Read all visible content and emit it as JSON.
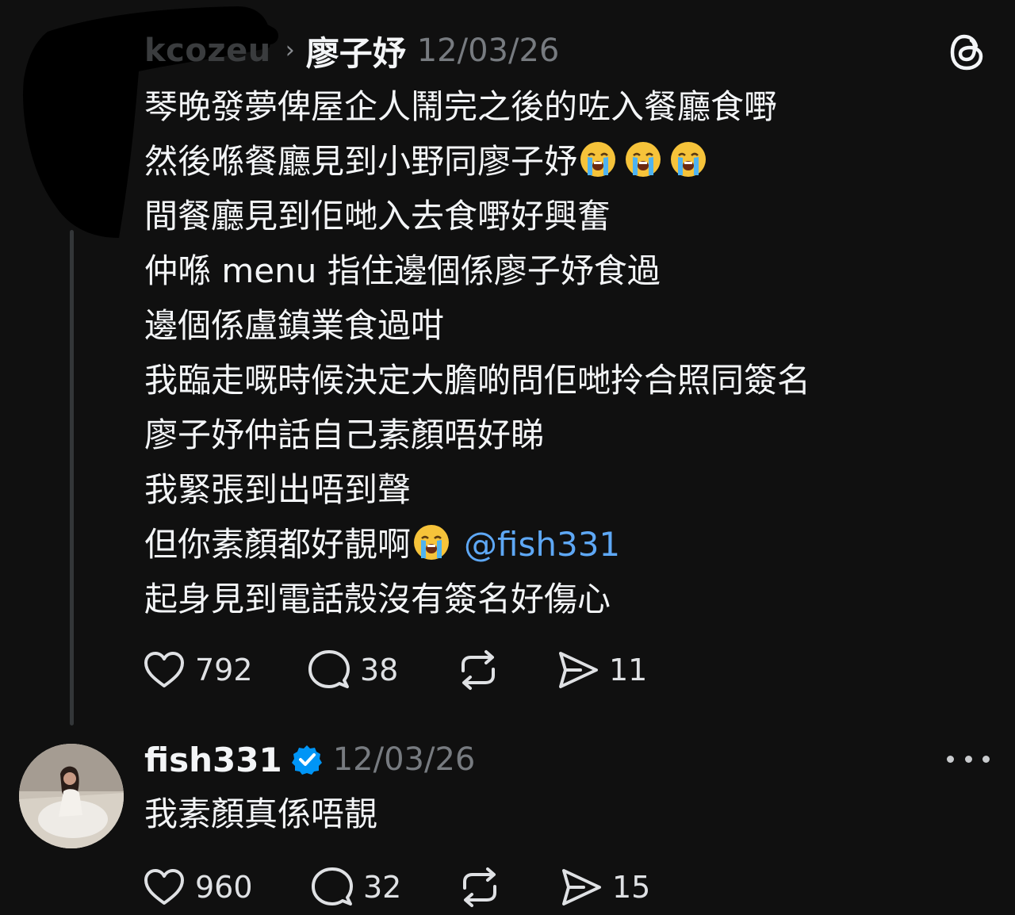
{
  "post1": {
    "author_handle": "kcozeu",
    "reply_to": "廖子妤",
    "date": "12/03/26",
    "lines": [
      "琴晚發夢俾屋企人鬧完之後的咗入餐廳食嘢",
      "然後喺餐廳見到小野同廖子妤",
      "間餐廳見到佢哋入去食嘢好興奮",
      "仲喺 menu 指住邊個係廖子妤食過",
      "邊個係盧鎮業食過咁",
      "我臨走嘅時候決定大膽啲問佢哋拎合照同簽名",
      "廖子妤仲話自己素顏唔好睇",
      "我緊張到出唔到聲",
      "但你素顏都好靚啊",
      "起身見到電話殼沒有簽名好傷心"
    ],
    "mention": "@fish331",
    "emoji": "loudly-crying-face",
    "actions": {
      "likes": "792",
      "replies": "38",
      "sends": "11"
    }
  },
  "post2": {
    "username": "fish331",
    "verified": true,
    "date": "12/03/26",
    "text": "我素顏真係唔靚",
    "actions": {
      "likes": "960",
      "replies": "32",
      "sends": "15"
    }
  },
  "icons": {
    "app": "threads-logo-icon",
    "like": "heart-icon",
    "reply": "comment-bubble-icon",
    "repost": "repost-icon",
    "share": "send-icon",
    "more": "more-dots-icon",
    "verified": "verified-badge-icon"
  },
  "colors": {
    "background": "#101010",
    "text": "#f3f5f7",
    "muted": "#777b80",
    "mention": "#5ea8f6",
    "verified": "#0095f6"
  }
}
